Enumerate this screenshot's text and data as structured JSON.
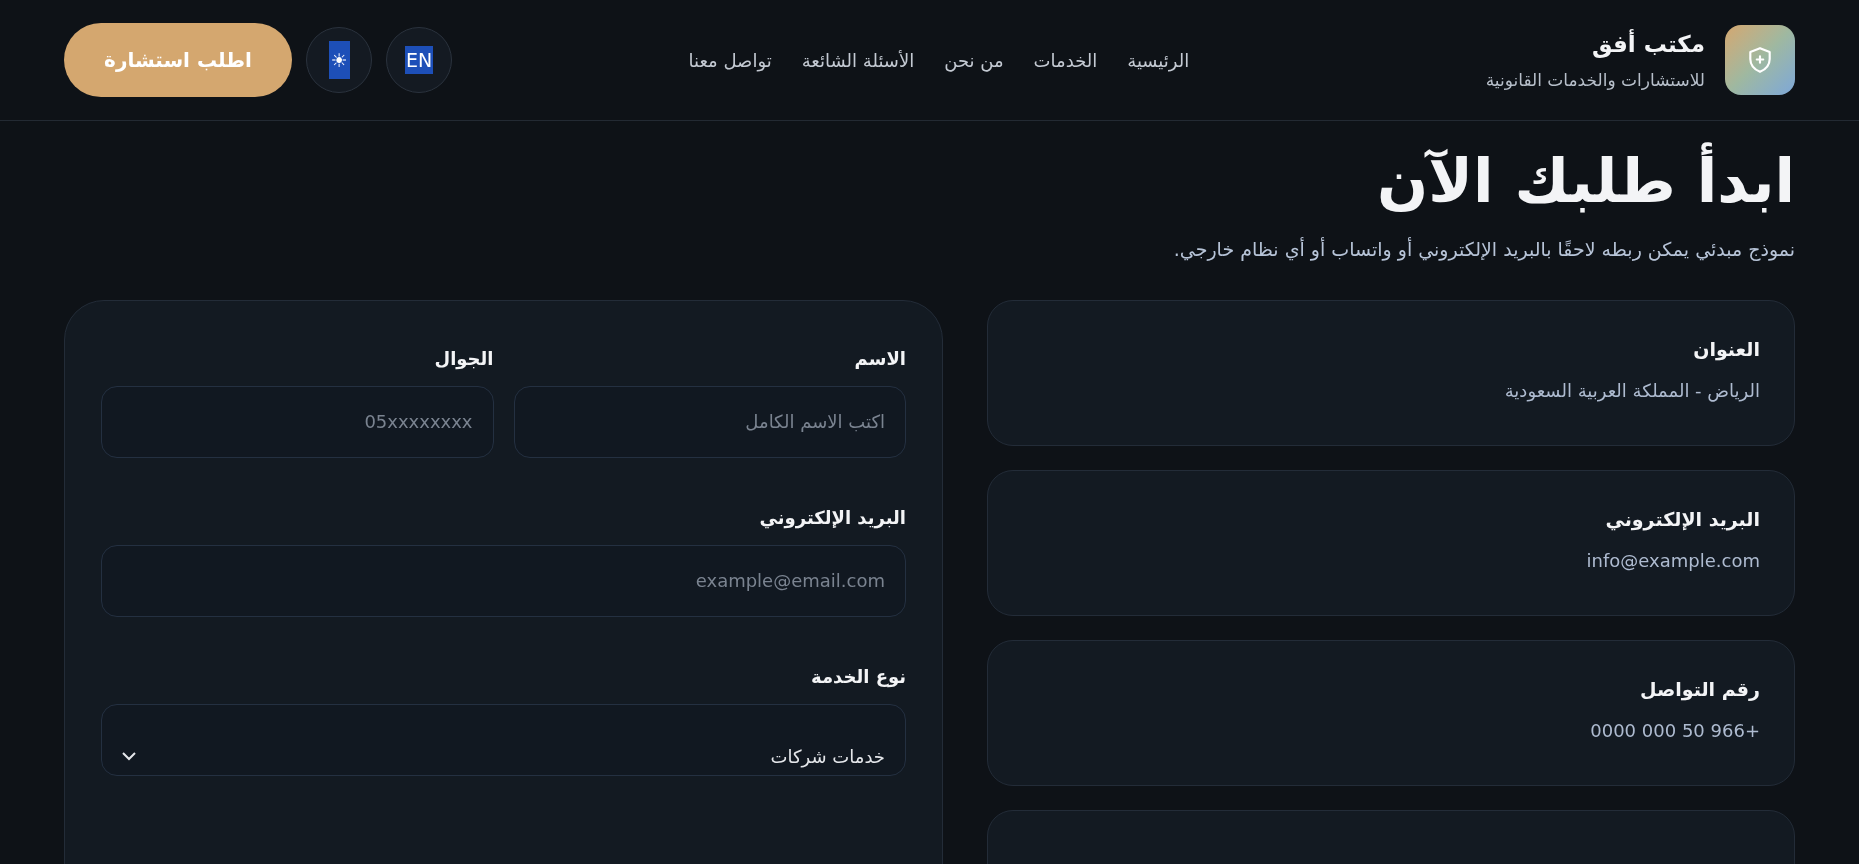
{
  "header": {
    "brand": {
      "title": "مكتب أفق",
      "subtitle": "للاستشارات والخدمات القانونية"
    },
    "nav": [
      {
        "label": "الرئيسية"
      },
      {
        "label": "الخدمات"
      },
      {
        "label": "من نحن"
      },
      {
        "label": "الأسئلة الشائعة"
      },
      {
        "label": "تواصل معنا"
      }
    ],
    "language_button": "EN",
    "theme_button": "☀",
    "cta_button": "اطلب استشارة"
  },
  "hero": {
    "title": "ابدأ طلبك الآن",
    "subtitle": "نموذج مبدئي يمكن ربطه لاحقًا بالبريد الإلكتروني أو واتساب أو أي نظام خارجي."
  },
  "contact_cards": [
    {
      "title": "العنوان",
      "value": "الرياض - المملكة العربية السعودية"
    },
    {
      "title": "البريد الإلكتروني",
      "value": "info@example.com"
    },
    {
      "title": "رقم التواصل",
      "value": "+966 50 000 0000"
    }
  ],
  "form": {
    "rows": [
      [
        {
          "label": "الاسم",
          "placeholder": "اكتب الاسم الكامل"
        },
        {
          "label": "الجوال",
          "placeholder": "05xxxxxxxx"
        }
      ],
      [
        {
          "label": "البريد الإلكتروني",
          "placeholder": "example@email.com"
        }
      ]
    ],
    "service": {
      "label": "نوع الخدمة",
      "value": "خدمات شركات"
    }
  }
}
